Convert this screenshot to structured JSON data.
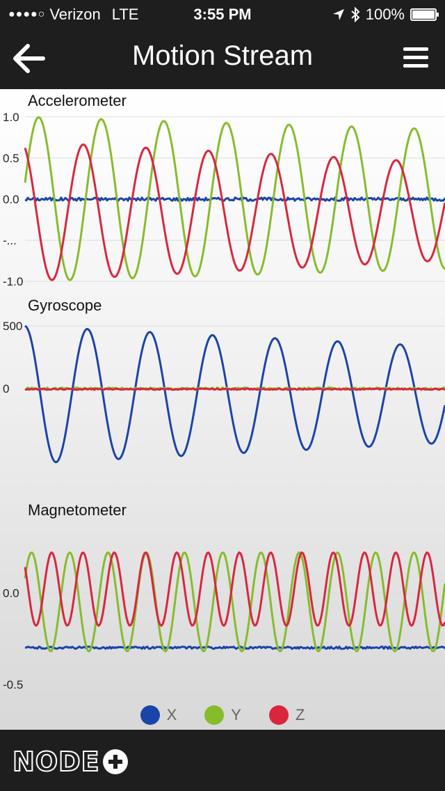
{
  "status_bar": {
    "carrier": "Verizon",
    "network": "LTE",
    "time": "3:55 PM",
    "battery": "100%",
    "battery_level": 1.0,
    "signal_dots": "●●●●○"
  },
  "nav": {
    "title": "Motion Stream",
    "back_icon": "arrow-left-icon",
    "menu_icon": "hamburger-menu-icon"
  },
  "colors": {
    "x": "#1a44a8",
    "y": "#86bc2c",
    "z": "#d9263d",
    "bar": "#1e1e1e"
  },
  "legend": [
    {
      "label": "X",
      "color": "#1a44a8"
    },
    {
      "label": "Y",
      "color": "#86bc2c"
    },
    {
      "label": "Z",
      "color": "#d9263d"
    }
  ],
  "footer": {
    "logo_text": "NODE"
  },
  "chart_data": [
    {
      "type": "line",
      "title": "Accelerometer",
      "ylim": [
        -1.1,
        1.1
      ],
      "yticks": [
        {
          "value": 1.0,
          "label": "1.0"
        },
        {
          "value": 0.5,
          "label": "0.5"
        },
        {
          "value": 0.0,
          "label": "0.0"
        },
        {
          "value": -0.5,
          "label": "-..."
        },
        {
          "value": -1.0,
          "label": "-1.0"
        }
      ],
      "grid": true,
      "series": [
        {
          "name": "X",
          "wave": {
            "base": 0.0,
            "amp": 0.0,
            "period": 90,
            "phase": 0,
            "decay": 0,
            "noise": 0.02
          }
        },
        {
          "name": "Y",
          "wave": {
            "base": 0.0,
            "amp": 1.0,
            "period": 90,
            "phase": 0.2,
            "decay": 0.15,
            "noise": 0.0
          }
        },
        {
          "name": "Z",
          "wave": {
            "base": -0.15,
            "amp": 0.85,
            "period": 90,
            "phase": 2.0,
            "decay": 0.3,
            "noise": 0.0
          }
        }
      ]
    },
    {
      "type": "line",
      "title": "Gyroscope",
      "ylim": [
        -900,
        600
      ],
      "yticks": [
        {
          "value": 500,
          "label": "500"
        },
        {
          "value": 0,
          "label": "0"
        }
      ],
      "grid": true,
      "series": [
        {
          "name": "X",
          "wave": {
            "base": -50,
            "amp": 550,
            "period": 90,
            "phase": 1.6,
            "decay": 0.3,
            "noise": 0
          }
        },
        {
          "name": "Y",
          "wave": {
            "base": 0,
            "amp": 0,
            "period": 90,
            "phase": 0,
            "decay": 0,
            "noise": 8
          }
        },
        {
          "name": "Z",
          "wave": {
            "base": -5,
            "amp": 0,
            "period": 90,
            "phase": 0,
            "decay": 0,
            "noise": 5
          }
        }
      ]
    },
    {
      "type": "line",
      "title": "Magnetometer",
      "ylim": [
        -0.55,
        0.4
      ],
      "yticks": [
        {
          "value": 0.0,
          "label": "0.0"
        },
        {
          "value": -0.5,
          "label": "-0.5"
        }
      ],
      "grid": true,
      "series": [
        {
          "name": "X",
          "wave": {
            "base": -0.3,
            "amp": 0.0,
            "period": 90,
            "phase": 0,
            "decay": 0,
            "noise": 0.006
          }
        },
        {
          "name": "Y",
          "wave": {
            "base": -0.05,
            "amp": 0.27,
            "period": 55,
            "phase": 0.5,
            "decay": 0,
            "noise": 0
          }
        },
        {
          "name": "Z",
          "wave": {
            "base": 0.02,
            "amp": 0.2,
            "period": 45,
            "phase": 2.5,
            "decay": 0,
            "noise": 0
          }
        }
      ]
    }
  ]
}
